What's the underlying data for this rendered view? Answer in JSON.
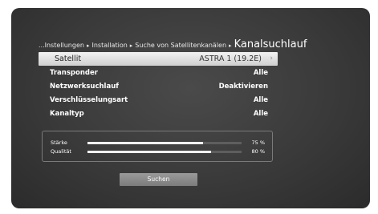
{
  "breadcrumb": {
    "items": [
      "...Instellungen",
      "Installation",
      "Suche von Satellitenkanälen"
    ],
    "separator": "▸",
    "current": "Kanalsuchlauf"
  },
  "menu": {
    "rows": [
      {
        "label": "Satellit",
        "value": "ASTRA 1 (19.2E)",
        "chevron": "›",
        "selected": true
      },
      {
        "label": "Transponder",
        "value": "Alle"
      },
      {
        "label": "Netzwerksuchlauf",
        "value": "Deaktivieren"
      },
      {
        "label": "Verschlüsselungsart",
        "value": "Alle"
      },
      {
        "label": "Kanaltyp",
        "value": "Alle"
      }
    ]
  },
  "signal": {
    "strength": {
      "label": "Stärke",
      "value": "75 %",
      "level": 0.75
    },
    "quality": {
      "label": "Qualität",
      "value": "80 %",
      "level": 0.8
    }
  },
  "search_button": {
    "label": "Suchen"
  },
  "colors": {
    "background": "#3a3a3a",
    "selected_row": "#e0e0e0",
    "button": "#8a8a8a",
    "bar_fill": "#f0f0f0"
  }
}
